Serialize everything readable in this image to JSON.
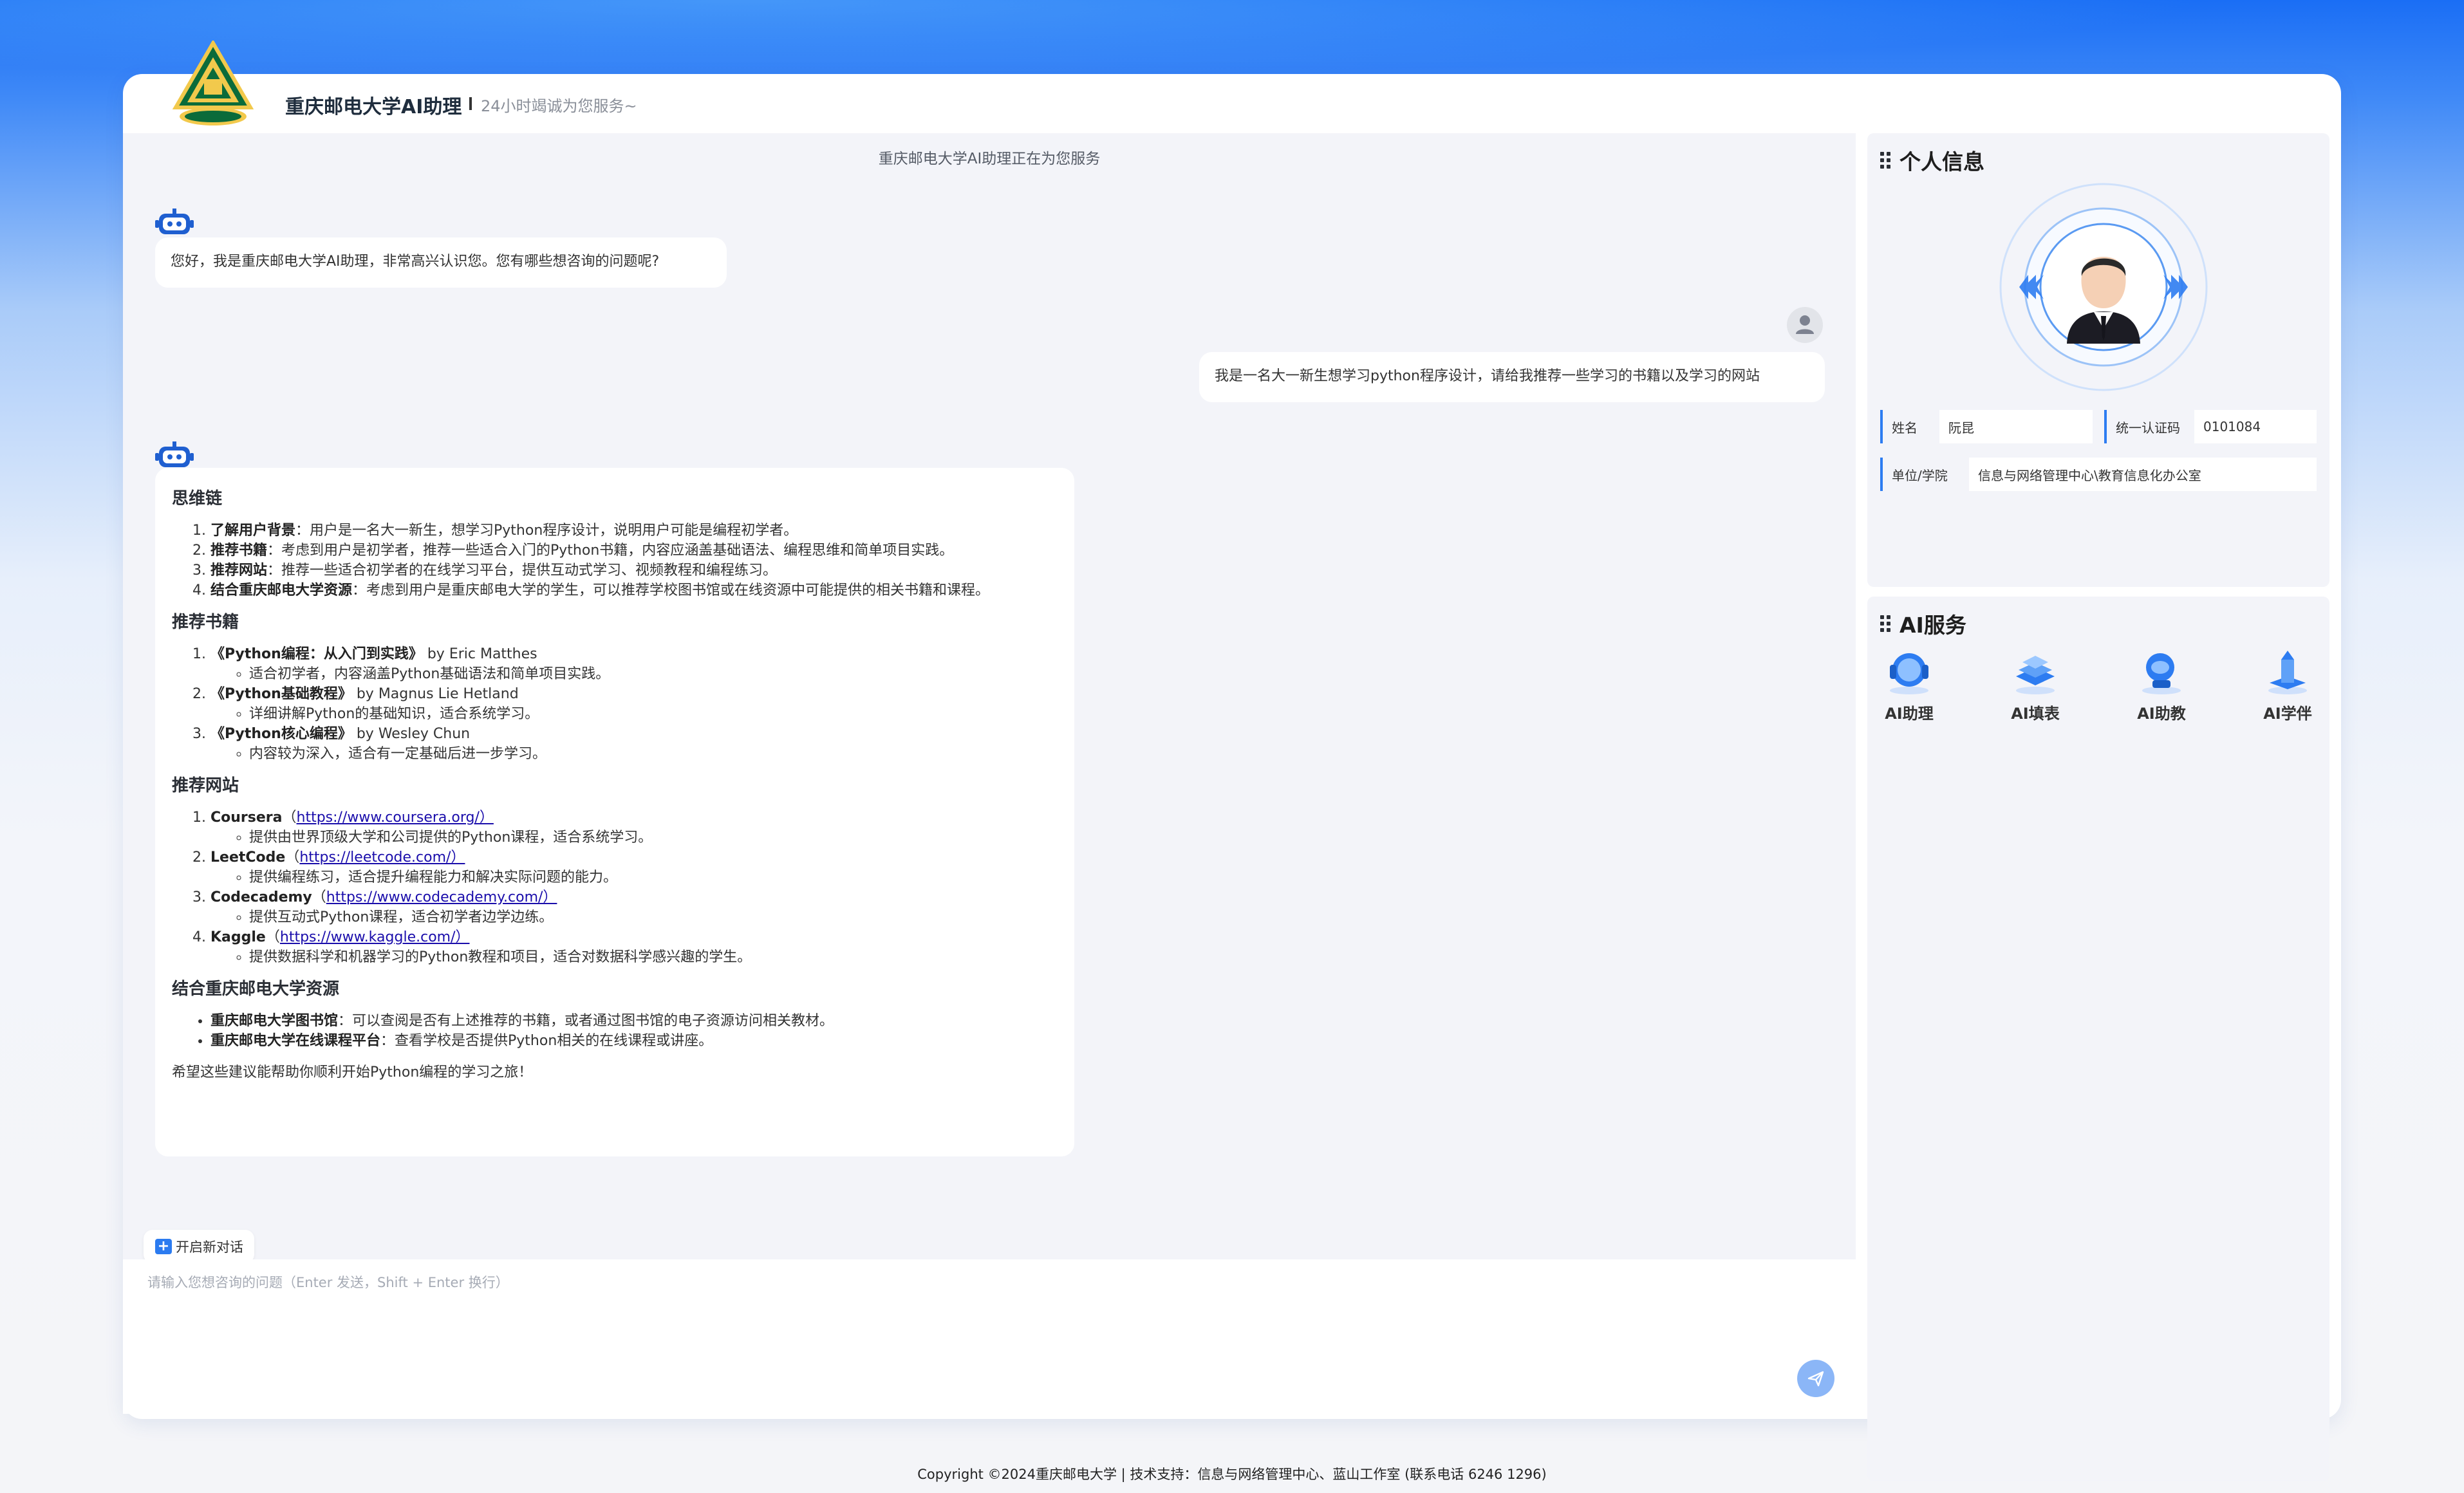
{
  "header": {
    "title": "重庆邮电大学AI助理",
    "subtitle": "24小时竭诚为您服务~"
  },
  "chat": {
    "status": "重庆邮电大学AI助理正在为您服务",
    "greeting": "您好，我是重庆邮电大学AI助理，非常高兴认识您。您有哪些想咨询的问题呢?",
    "user_message": "我是一名大一新生想学习python程序设计，请给我推荐一些学习的书籍以及学习的网站",
    "reply": {
      "s1_title": "思维链",
      "s1_items": [
        {
          "bold": "了解用户背景",
          "text": "：用户是一名大一新生，想学习Python程序设计，说明用户可能是编程初学者。"
        },
        {
          "bold": "推荐书籍",
          "text": "：考虑到用户是初学者，推荐一些适合入门的Python书籍，内容应涵盖基础语法、编程思维和简单项目实践。"
        },
        {
          "bold": "推荐网站",
          "text": "：推荐一些适合初学者的在线学习平台，提供互动式学习、视频教程和编程练习。"
        },
        {
          "bold": "结合重庆邮电大学资源",
          "text": "：考虑到用户是重庆邮电大学的学生，可以推荐学校图书馆或在线资源中可能提供的相关书籍和课程。"
        }
      ],
      "s2_title": "推荐书籍",
      "s2_items": [
        {
          "bold": "《Python编程：从入门到实践》",
          "text": " by Eric Matthes",
          "sub": "适合初学者，内容涵盖Python基础语法和简单项目实践。"
        },
        {
          "bold": "《Python基础教程》",
          "text": " by Magnus Lie Hetland",
          "sub": "详细讲解Python的基础知识，适合系统学习。"
        },
        {
          "bold": "《Python核心编程》",
          "text": " by Wesley Chun",
          "sub": "内容较为深入，适合有一定基础后进一步学习。"
        }
      ],
      "s3_title": "推荐网站",
      "s3_items": [
        {
          "bold": "Coursera",
          "pre": "（",
          "link": "https://www.coursera.org/）",
          "sub": "提供由世界顶级大学和公司提供的Python课程，适合系统学习。"
        },
        {
          "bold": "LeetCode",
          "pre": "（",
          "link": "https://leetcode.com/）",
          "sub": "提供编程练习，适合提升编程能力和解决实际问题的能力。"
        },
        {
          "bold": "Codecademy",
          "pre": "（",
          "link": "https://www.codecademy.com/）",
          "sub": "提供互动式Python课程，适合初学者边学边练。"
        },
        {
          "bold": "Kaggle",
          "pre": "（",
          "link": "https://www.kaggle.com/）",
          "sub": "提供数据科学和机器学习的Python教程和项目，适合对数据科学感兴趣的学生。"
        }
      ],
      "s4_title": "结合重庆邮电大学资源",
      "s4_items": [
        {
          "bold": "重庆邮电大学图书馆",
          "text": "：可以查阅是否有上述推荐的书籍，或者通过图书馆的电子资源访问相关教材。"
        },
        {
          "bold": "重庆邮电大学在线课程平台",
          "text": "：查看学校是否提供Python相关的在线课程或讲座。"
        }
      ],
      "closing": "希望这些建议能帮助你顺利开始Python编程的学习之旅！"
    },
    "new_chat_label": "开启新对话",
    "input_placeholder": "请输入您想咨询的问题（Enter 发送，Shift + Enter 换行）"
  },
  "profile": {
    "title": "个人信息",
    "name_label": "姓名",
    "name_value": "阮昆",
    "id_label": "统一认证码",
    "id_value": "0101084",
    "unit_label": "单位/学院",
    "unit_value": "信息与网络管理中心\\教育信息化办公室"
  },
  "ai_services": {
    "title": "AI服务",
    "items": [
      {
        "label": "AI助理",
        "icon": "headset-robot-icon"
      },
      {
        "label": "AI填表",
        "icon": "form-stack-icon"
      },
      {
        "label": "AI助教",
        "icon": "teaching-robot-icon"
      },
      {
        "label": "AI学伴",
        "icon": "study-tower-icon"
      }
    ]
  },
  "footer": {
    "text": "Copyright ©2024重庆邮电大学 | 技术支持：信息与网络管理中心、蓝山工作室 (联系电话 6246 1296)"
  },
  "colors": {
    "accent": "#2d7cf1",
    "send_button": "#8bb6f7",
    "panel_bg": "#f3f4f9"
  }
}
